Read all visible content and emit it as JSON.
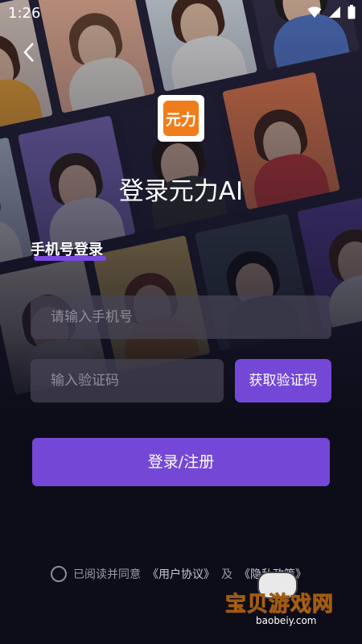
{
  "status_bar": {
    "time": "1:26"
  },
  "logo": {
    "text": "元力"
  },
  "header": {
    "title": "登录元力AI"
  },
  "tabs": {
    "active_label": "手机号登录"
  },
  "form": {
    "phone_placeholder": "请输入手机号",
    "code_placeholder": "输入验证码",
    "get_code_label": "获取验证码",
    "submit_label": "登录/注册"
  },
  "agreement": {
    "prefix": "已阅读并同意",
    "user_agreement": "《用户协议》",
    "conjunction": "及",
    "privacy_policy": "《隐私政策》"
  },
  "watermark": {
    "text": "宝贝游戏网",
    "url": "baobeiy.com"
  },
  "colors": {
    "accent": "#7447d6",
    "background": "#0d0d19",
    "logo_orange": "#f07d1a"
  }
}
